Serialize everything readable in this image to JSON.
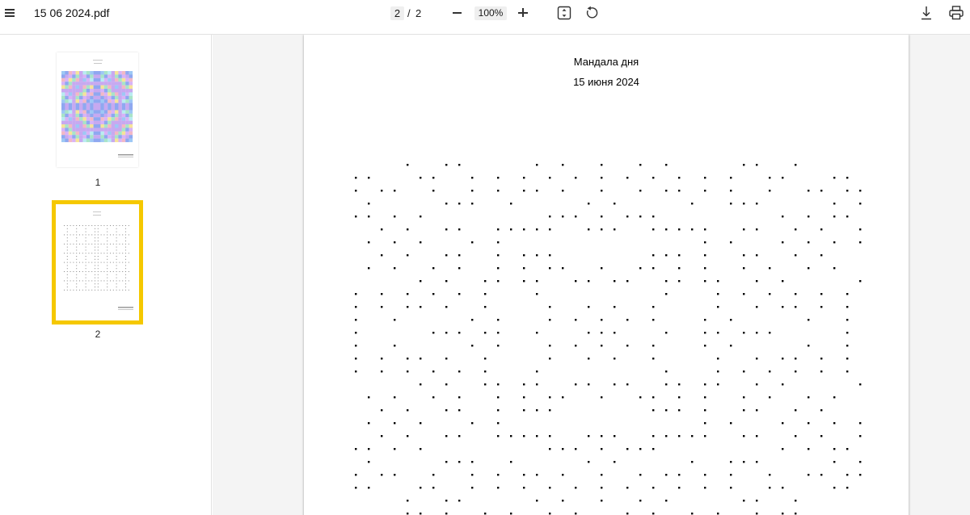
{
  "toolbar": {
    "file_name": "15 06 2024.pdf",
    "current_page": "2",
    "page_separator": "/",
    "total_pages": "2",
    "zoom": "100%"
  },
  "sidebar": {
    "thumbnails": [
      {
        "label": "1",
        "selected": false
      },
      {
        "label": "2",
        "selected": true
      }
    ]
  },
  "document": {
    "title": "Мандала дня",
    "date": "15 июня 2024"
  },
  "colors": {
    "selection": "#f5c800",
    "viewer_bg": "#f4f4f4"
  },
  "icons": [
    "menu-icon",
    "zoom-out-icon",
    "zoom-in-icon",
    "fit-page-icon",
    "rotate-icon",
    "download-icon",
    "print-icon"
  ]
}
